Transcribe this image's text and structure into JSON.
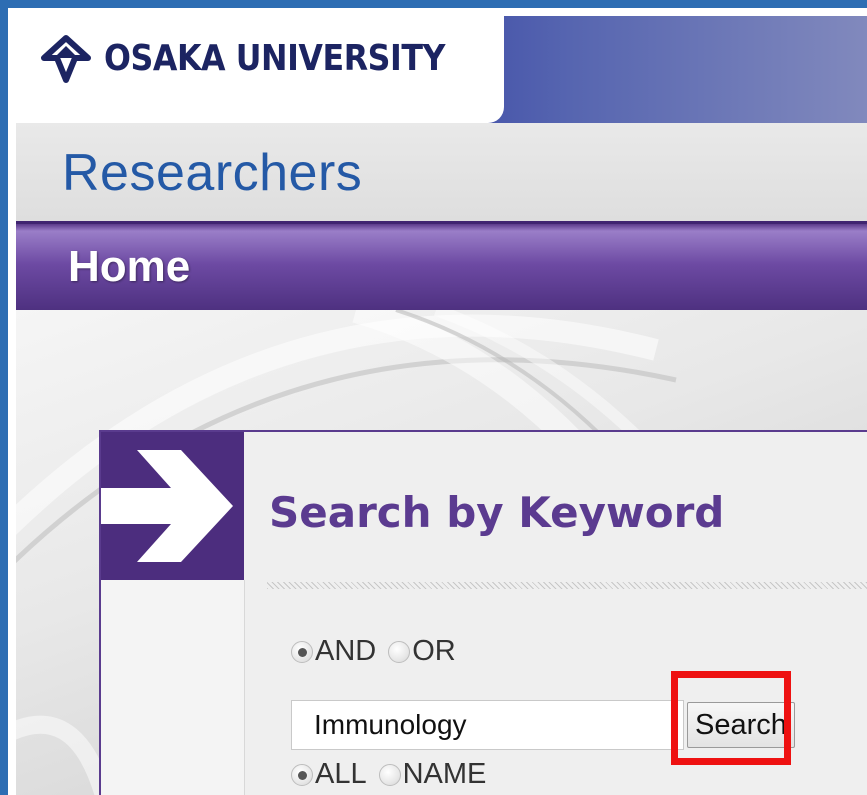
{
  "header": {
    "university_name": "OSAKA UNIVERSITY",
    "section_title": "Researchers",
    "logo_icon": "university-logo-icon"
  },
  "nav": {
    "home_label": "Home"
  },
  "search": {
    "heading": "Search by Keyword",
    "arrow_icon": "right-arrow-icon",
    "match_options": [
      {
        "label": "AND",
        "checked": true
      },
      {
        "label": "OR",
        "checked": false
      }
    ],
    "scope_options": [
      {
        "label": "ALL",
        "checked": true
      },
      {
        "label": "NAME",
        "checked": false
      }
    ],
    "keyword_value": "Immunology",
    "button_label": "Search"
  },
  "colors": {
    "frame_border": "#2d6db3",
    "brand_navy": "#1c2462",
    "title_blue": "#2459a6",
    "nav_purple": "#6d4aa3",
    "heading_purple": "#5b3b90",
    "highlight_red": "#ee1111"
  }
}
